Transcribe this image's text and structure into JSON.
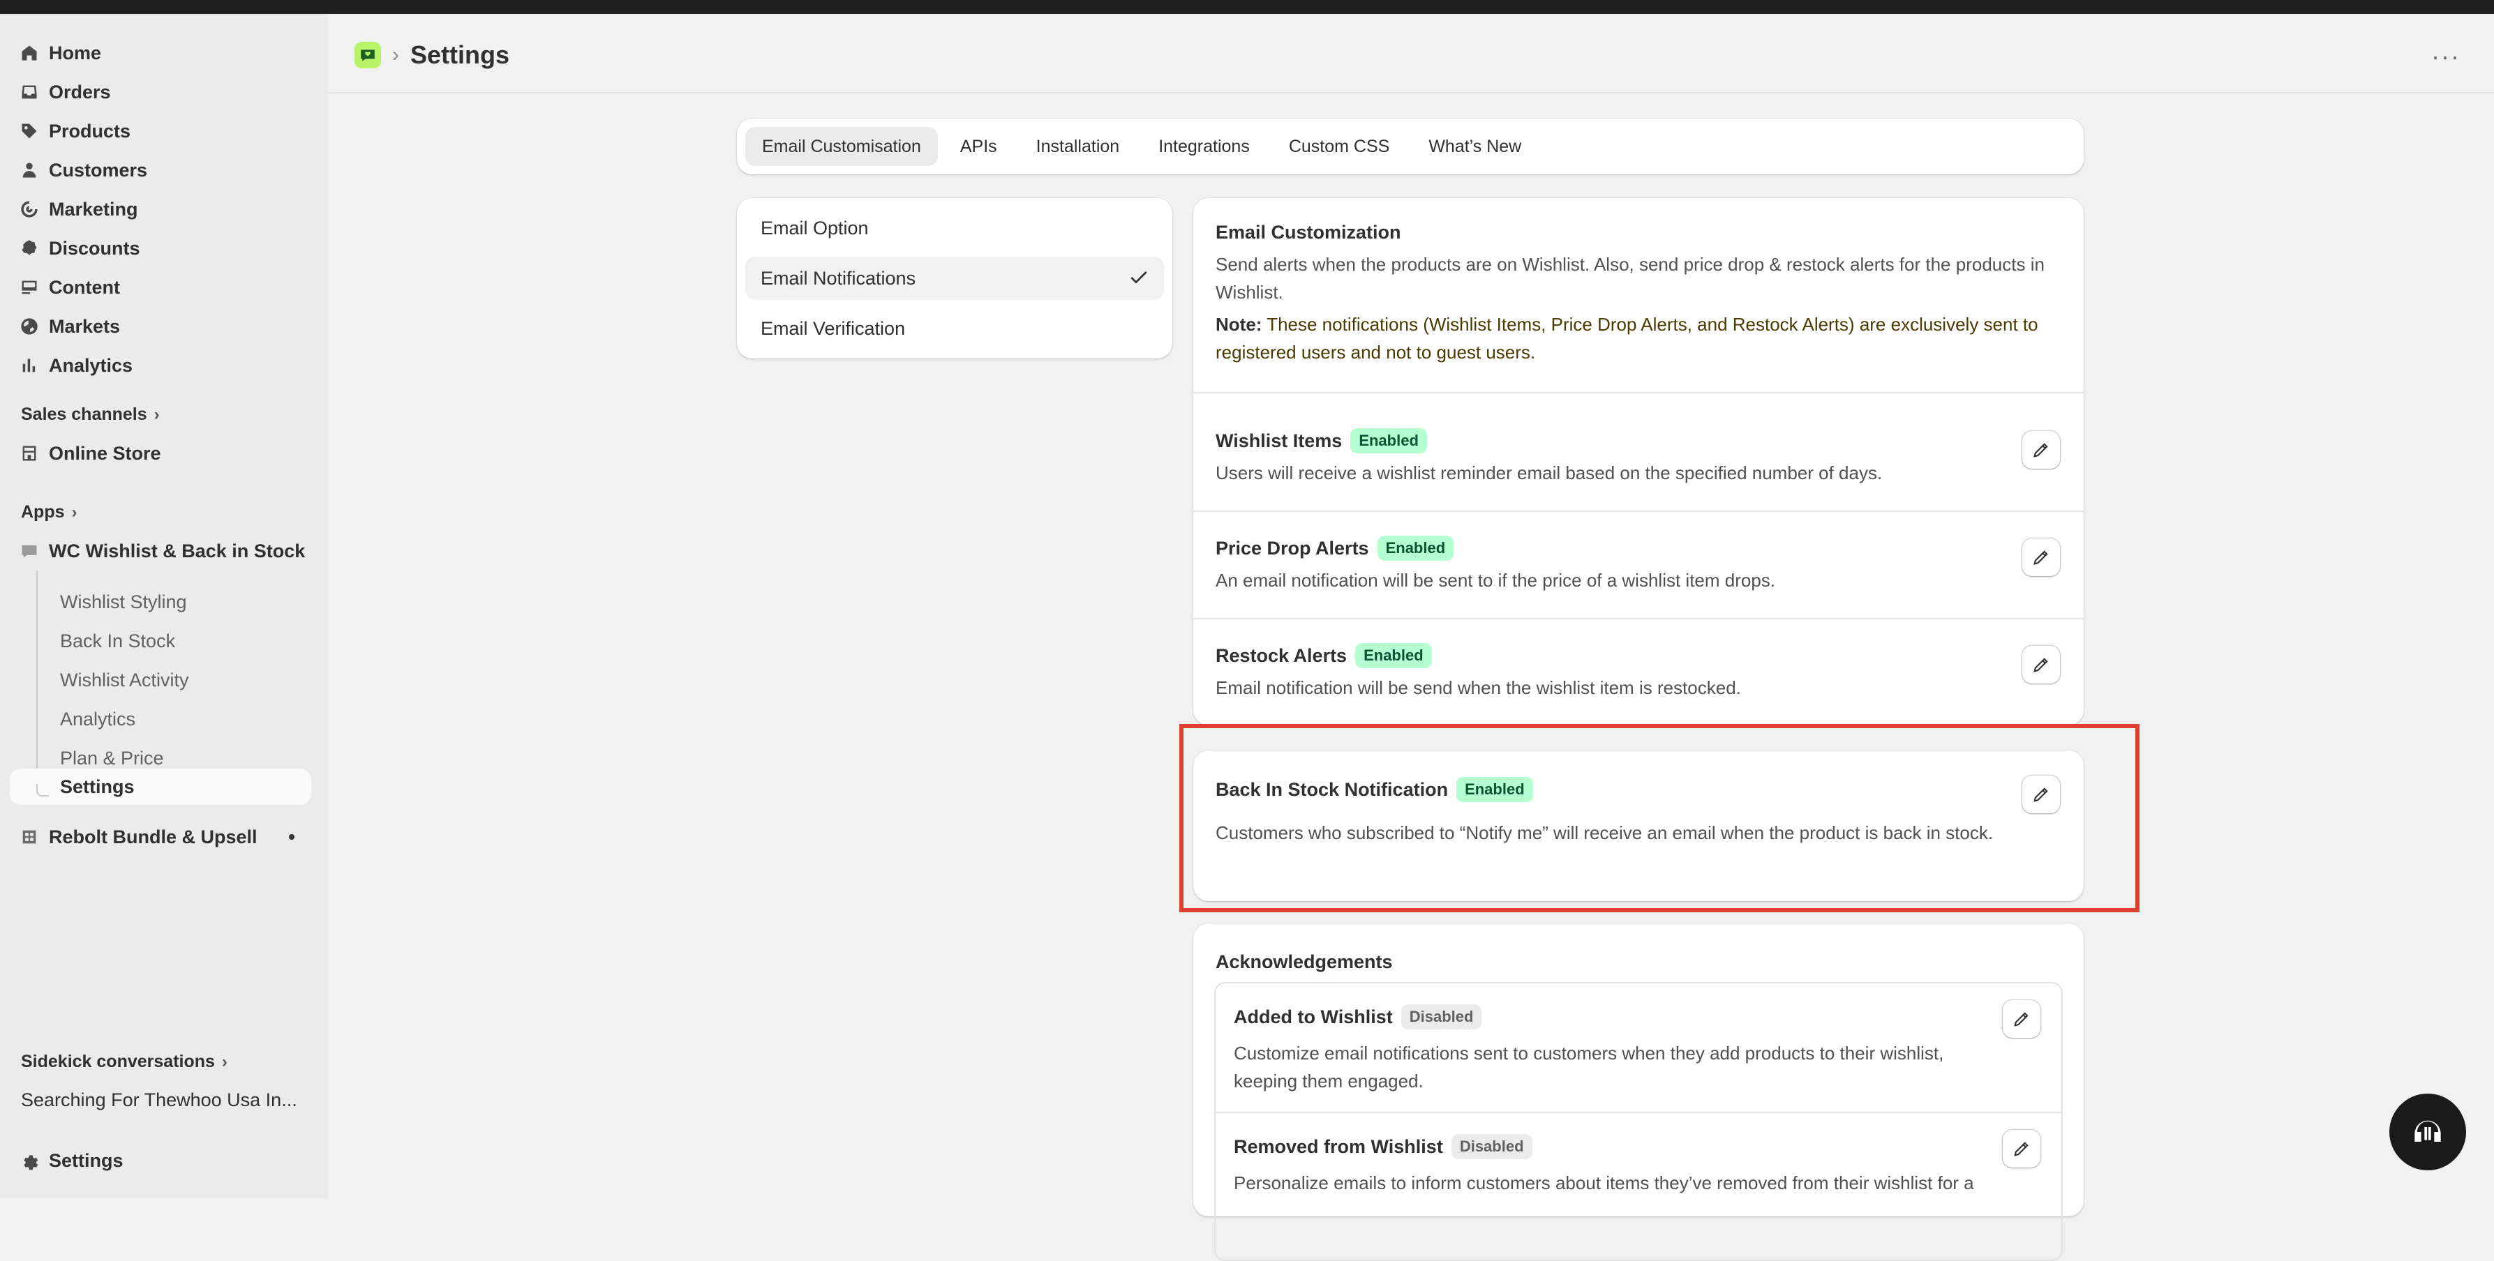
{
  "sidebar": {
    "nav": [
      {
        "label": "Home",
        "icon": "home-icon"
      },
      {
        "label": "Orders",
        "icon": "inbox-icon"
      },
      {
        "label": "Products",
        "icon": "tag-icon"
      },
      {
        "label": "Customers",
        "icon": "person-icon"
      },
      {
        "label": "Marketing",
        "icon": "target-icon"
      },
      {
        "label": "Discounts",
        "icon": "discount-icon"
      },
      {
        "label": "Content",
        "icon": "content-icon"
      },
      {
        "label": "Markets",
        "icon": "globe-icon"
      },
      {
        "label": "Analytics",
        "icon": "bar-chart-icon"
      }
    ],
    "sales_channels_label": "Sales channels",
    "online_store": "Online Store",
    "apps_label": "Apps",
    "app_name": "WC Wishlist & Back in Stock",
    "app_subitems": [
      "Wishlist Styling",
      "Back In Stock",
      "Wishlist Activity",
      "Analytics",
      "Plan & Price",
      "Settings"
    ],
    "second_app": "Rebolt Bundle & Upsell",
    "sidekick_label": "Sidekick conversations",
    "sidekick_item": "Searching For Thewhoo Usa In...",
    "settings": "Settings"
  },
  "header": {
    "separator": "›",
    "title": "Settings",
    "more": "···"
  },
  "tabs": [
    "Email Customisation",
    "APIs",
    "Installation",
    "Integrations",
    "Custom CSS",
    "What’s New"
  ],
  "options": [
    "Email Option",
    "Email Notifications",
    "Email Verification"
  ],
  "email_customization": {
    "title": "Email Customization",
    "description": "Send alerts when the products are on Wishlist. Also, send price drop & restock alerts for the products in Wishlist.",
    "note_label": "Note:",
    "note_text": " These notifications (Wishlist Items, Price Drop Alerts, and Restock Alerts) are exclusively sent to registered users and not to guest users.",
    "rows": [
      {
        "title": "Wishlist Items",
        "status": "Enabled",
        "desc": "Users will receive a wishlist reminder email based on the specified number of days."
      },
      {
        "title": "Price Drop Alerts",
        "status": "Enabled",
        "desc": "An email notification will be sent to if the price of a wishlist item drops."
      },
      {
        "title": "Restock Alerts",
        "status": "Enabled",
        "desc": "Email notification will be send when the wishlist item is restocked."
      }
    ]
  },
  "back_in_stock": {
    "title": "Back In Stock Notification",
    "status": "Enabled",
    "desc": "Customers who subscribed to “Notify me” will receive an email when the product is back in stock."
  },
  "acknowledgements": {
    "title": "Acknowledgements",
    "rows": [
      {
        "title": "Added to Wishlist",
        "status": "Disabled",
        "desc": "Customize email notifications sent to customers when they add products to their wishlist, keeping them engaged."
      },
      {
        "title": "Removed from Wishlist",
        "status": "Disabled",
        "desc": "Personalize emails to inform customers about items they’ve removed from their wishlist for a"
      }
    ]
  },
  "colors": {
    "accent_green": "#b4fed2",
    "highlight": "#e0402f",
    "app_logo": "#b9f36a"
  }
}
